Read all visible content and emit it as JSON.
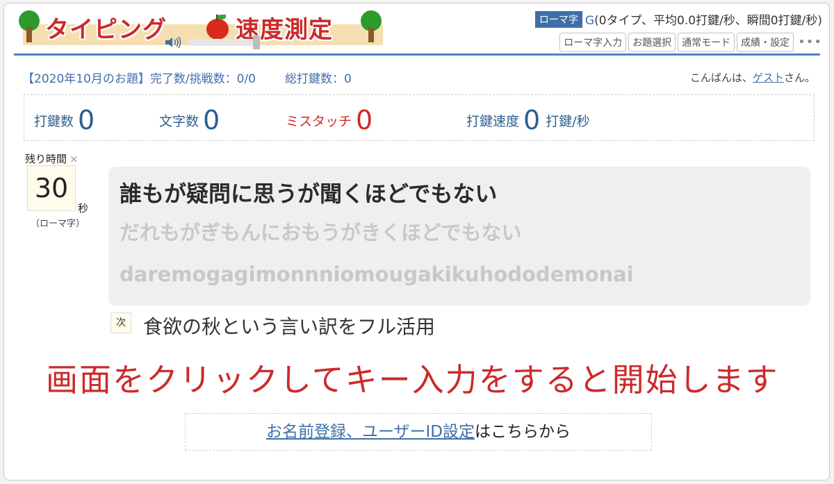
{
  "logo": {
    "text_part1": "タイピング",
    "text_part2": "速度測定",
    "icons": [
      "tree-icon",
      "apple-icon"
    ]
  },
  "header": {
    "mode_badge": "ローマ字",
    "grade": "G",
    "status": "(0タイプ、平均0.0打鍵/秒、瞬間0打鍵/秒)",
    "nav": [
      "ローマ字入力",
      "お題選択",
      "通常モード",
      "成績・設定"
    ],
    "more": "•••"
  },
  "info": {
    "monthly": "【2020年10月のお題】完了数/挑戦数：0/0",
    "total": "総打鍵数：0",
    "greeting_pre": "こんばんは、",
    "guest": "ゲスト",
    "greeting_post": "さん。"
  },
  "stats": {
    "keystrokes_label": "打鍵数",
    "keystrokes": "0",
    "chars_label": "文字数",
    "chars": "0",
    "miss_label": "ミスタッチ",
    "miss": "0",
    "speed_label": "打鍵速度",
    "speed": "0",
    "speed_unit": "打鍵/秒"
  },
  "timer": {
    "label": "残り時間",
    "close": "×",
    "value": "30",
    "unit": "秒",
    "mode": "（ローマ字）"
  },
  "prompt": {
    "kanji": "誰もが疑問に思うが聞くほどでもない",
    "kana": "だれもがぎもんにおもうがきくほどでもない",
    "romaji": "daremogagimonnniomougakikuhododemonai"
  },
  "next": {
    "badge": "次",
    "text": "食欲の秋という言い訳をフル活用"
  },
  "start_message": "画面をクリックしてキー入力をすると開始します",
  "register": {
    "link": "お名前登録、ユーザーID設定",
    "suffix": "はこちらから"
  },
  "colors": {
    "accent_blue": "#3f6fa8",
    "alert_red": "#cc2a2a",
    "panel_bg": "#efefef",
    "timer_bg": "#fffceb"
  }
}
